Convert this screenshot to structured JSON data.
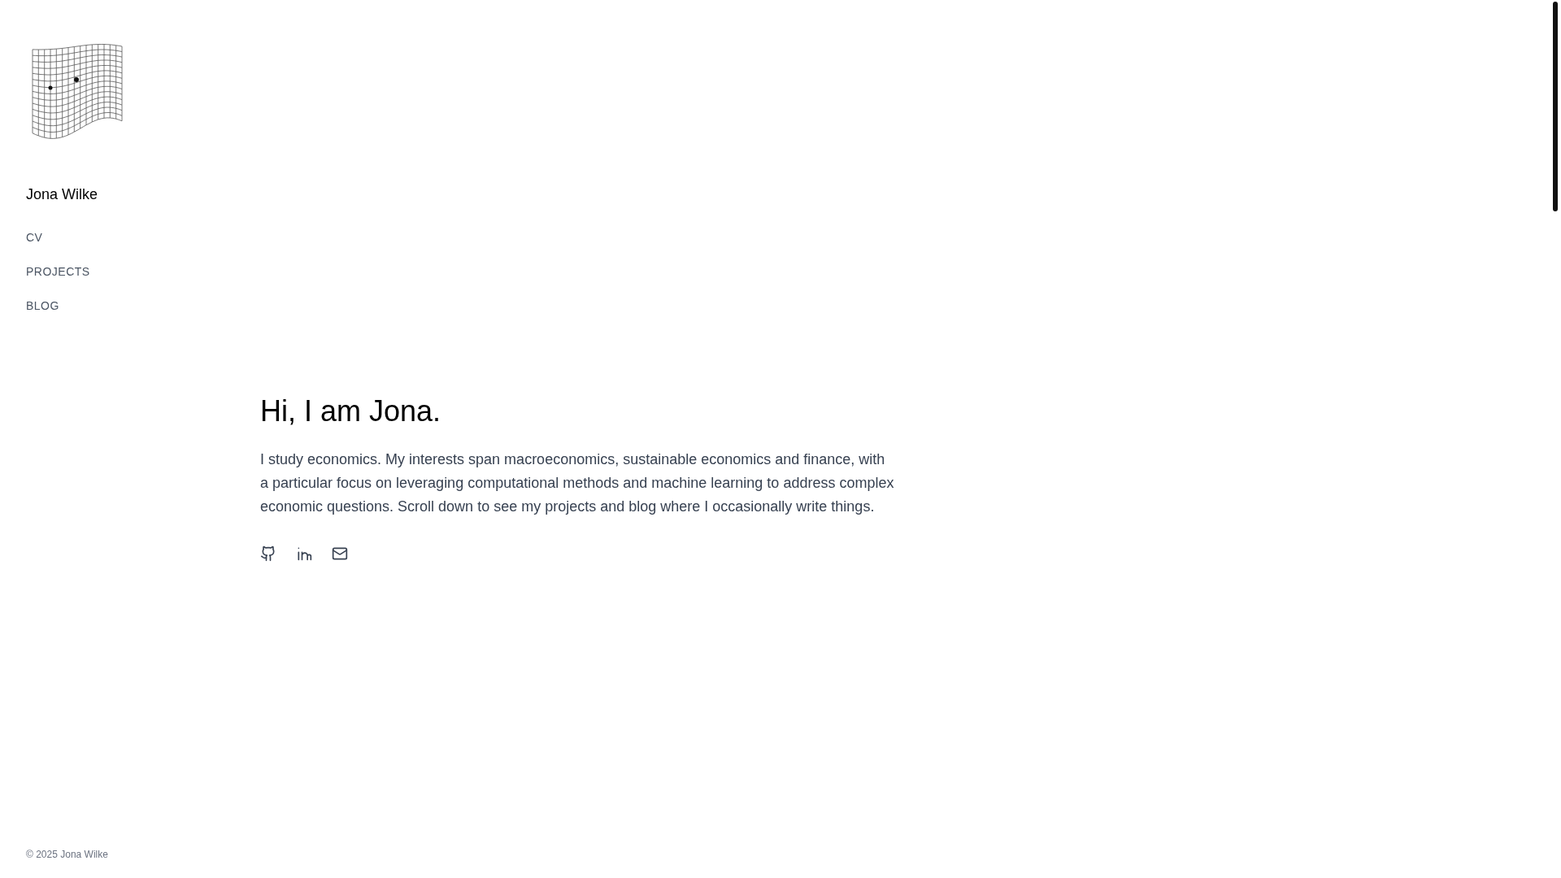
{
  "site_name": "Jona Wilke",
  "nav": [
    {
      "label": "CV"
    },
    {
      "label": "PROJECTS"
    },
    {
      "label": "BLOG"
    }
  ],
  "heading": "Hi, I am Jona.",
  "intro": "I study economics. My interests span macroeconomics, sustainable economics and finance, with a particular focus on leveraging computational methods and machine learning to address complex economic questions. Scroll down to see my projects and blog where I occasionally write things.",
  "social_links": [
    {
      "kind": "github"
    },
    {
      "kind": "linkedin"
    },
    {
      "kind": "email"
    }
  ],
  "footer": "© 2025 Jona Wilke"
}
